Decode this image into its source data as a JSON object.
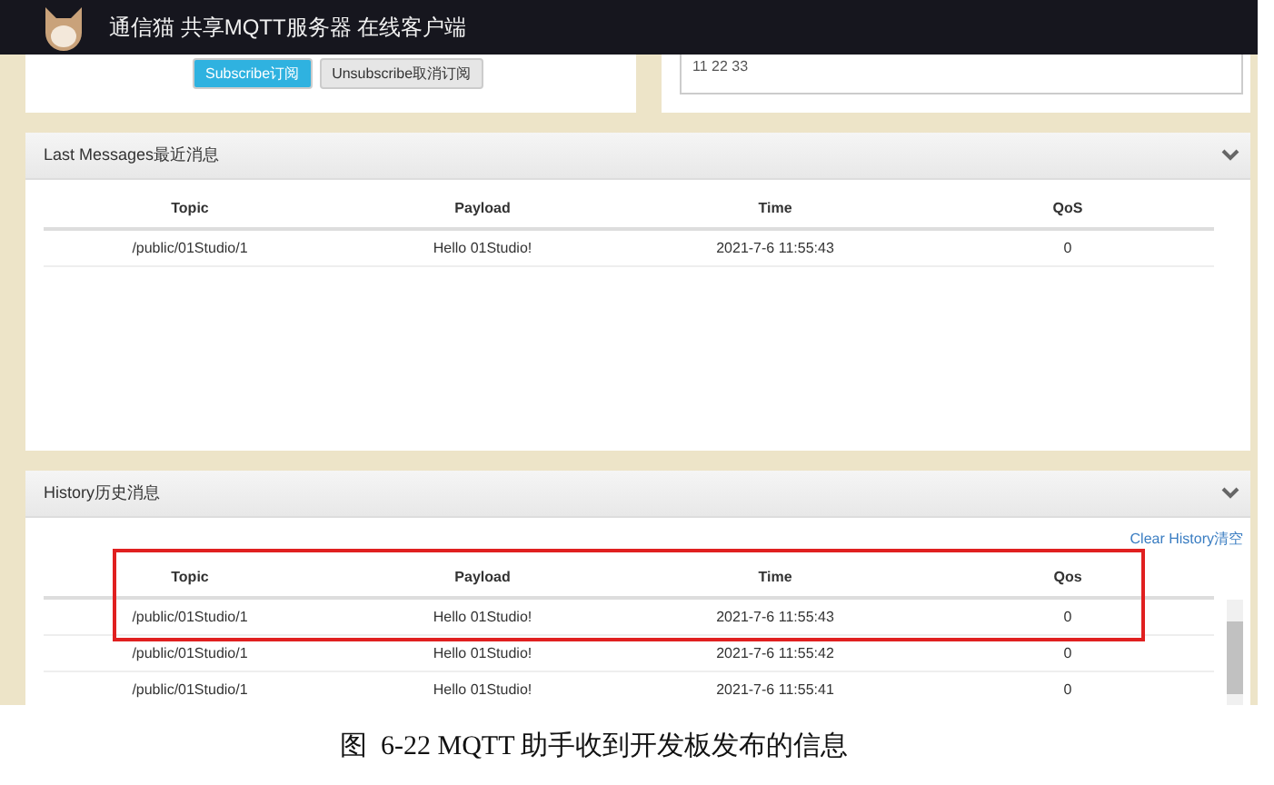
{
  "header": {
    "title": "通信猫 共享MQTT服务器 在线客户端"
  },
  "subscribe_panel": {
    "buttons": [
      {
        "label": "Subscribe订阅",
        "kind": "primary"
      },
      {
        "label": "Unsubscribe取消订阅",
        "kind": "default"
      }
    ]
  },
  "publish_panel": {
    "message": "11 22 33"
  },
  "last_messages": {
    "title": "Last Messages最近消息",
    "columns": [
      "Topic",
      "Payload",
      "Time",
      "QoS"
    ],
    "rows": [
      {
        "cells": [
          "/public/01Studio/1",
          "Hello 01Studio!",
          "2021-7-6 11:55:43",
          "0"
        ],
        "highlighted": false
      }
    ]
  },
  "history": {
    "title": "History历史消息",
    "clear_link": "Clear History清空",
    "header_highlighted": true,
    "columns": [
      "Topic",
      "Payload",
      "Time",
      "Qos"
    ],
    "rows": [
      {
        "cells": [
          "/public/01Studio/1",
          "Hello 01Studio!",
          "2021-7-6 11:55:43",
          "0"
        ],
        "highlighted": true
      },
      {
        "cells": [
          "/public/01Studio/1",
          "Hello 01Studio!",
          "2021-7-6 11:55:42",
          "0"
        ],
        "highlighted": false
      },
      {
        "cells": [
          "/public/01Studio/1",
          "Hello 01Studio!",
          "2021-7-6 11:55:41",
          "0"
        ],
        "highlighted": false
      }
    ]
  },
  "caption": "图  6-22 MQTT 助手收到开发板发布的信息"
}
